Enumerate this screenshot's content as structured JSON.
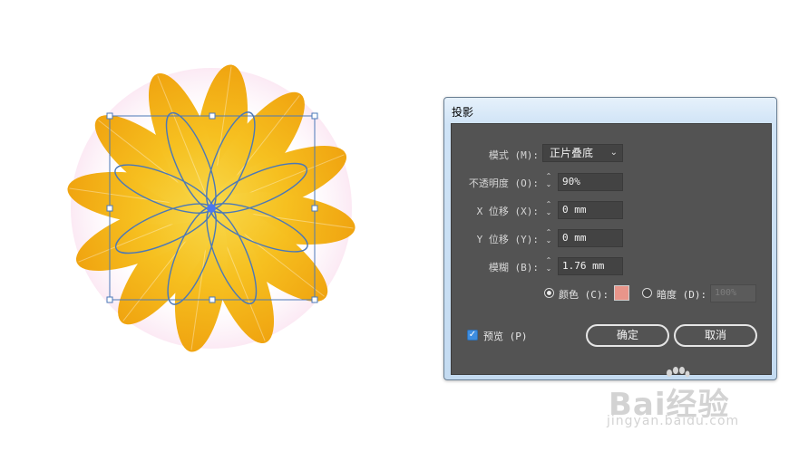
{
  "dialog": {
    "title": "投影",
    "mode_label": "模式 (M):",
    "mode_value": "正片叠底",
    "opacity_label": "不透明度 (O):",
    "opacity_value": "90%",
    "x_label": "X 位移 (X):",
    "x_value": "0 mm",
    "y_label": "Y 位移 (Y):",
    "y_value": "0 mm",
    "blur_label": "模糊 (B):",
    "blur_value": "1.76 mm",
    "color_label": "颜色 (C):",
    "darkness_label": "暗度 (D):",
    "darkness_value": "100%",
    "preview_label": "预览 (P)",
    "ok_label": "确定",
    "cancel_label": "取消",
    "color_selected": true,
    "preview_checked": true,
    "shadow_color": "#e8958a"
  },
  "artwork": {
    "petal_colors": [
      "#f7d23a",
      "#f2ad12"
    ],
    "selection_color": "#4a78b8"
  },
  "watermark": {
    "brand": "Bai经验",
    "url": "jingyan.baidu.com"
  }
}
